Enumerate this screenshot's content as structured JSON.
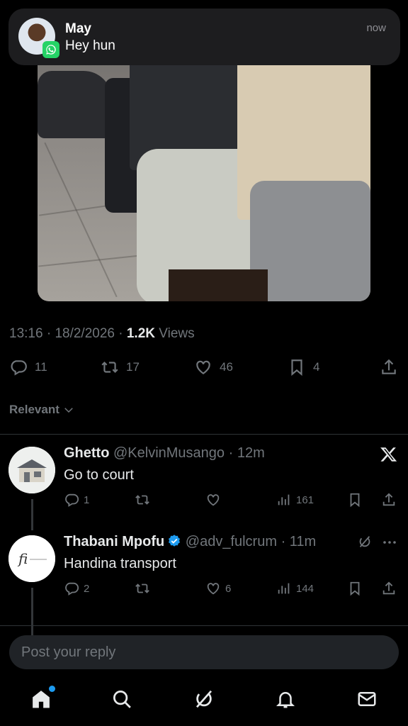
{
  "notification": {
    "sender": "May",
    "message": "Hey hun",
    "time": "now",
    "app_icon": "whatsapp-icon"
  },
  "post": {
    "time": "13:16",
    "date": "18/2/2026",
    "views_count": "1.2K",
    "views_label": "Views",
    "replies": "11",
    "reposts": "17",
    "likes": "46",
    "bookmarks": "4"
  },
  "sort": {
    "label": "Relevant"
  },
  "replies": [
    {
      "name": "Ghetto",
      "handle": "@KelvinMusango",
      "time": "12m",
      "text": "Go to court",
      "replies": "1",
      "reposts": "",
      "likes": "",
      "views": "161"
    },
    {
      "name": "Thabani Mpofu",
      "handle": "@adv_fulcrum",
      "time": "11m",
      "text": "Handina transport",
      "replies": "2",
      "reposts": "",
      "likes": "6",
      "views": "144",
      "verified": true
    }
  ],
  "composer": {
    "placeholder": "Post your reply"
  },
  "colors": {
    "accent": "#1d9bf0",
    "muted": "#71767b",
    "background": "#000000"
  }
}
